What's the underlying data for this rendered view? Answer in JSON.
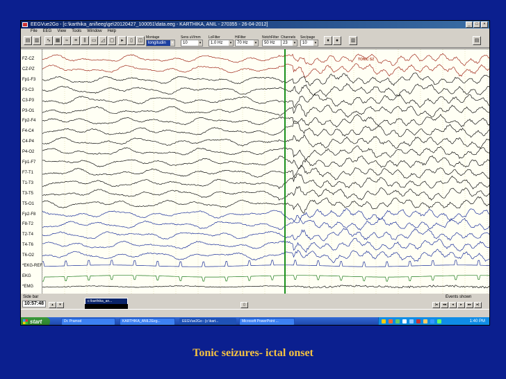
{
  "window": {
    "title": "EEGVue2Go - [c:\\karthika_anil\\eeg\\ge\\20120427_100051\\data.eeg - KARTHIKA, ANIL - 270355 - 26-04-2012]",
    "minimize": "_",
    "restore": "□",
    "close": "×"
  },
  "menu": [
    "File",
    "EEG",
    "View",
    "Tools",
    "Window",
    "Help"
  ],
  "toolbar": {
    "montage": {
      "label": "Montage",
      "value": "longitudin"
    },
    "sensitivity": {
      "label": "Sens uV/mm",
      "value": "10"
    },
    "lo_filter": {
      "label": "LoFilter",
      "value": "1.0 Hz"
    },
    "hi_filter": {
      "label": "HiFilter",
      "value": "70 Hz"
    },
    "notch_filter": {
      "label": "NotchFilter",
      "value": "50 Hz"
    },
    "channels": {
      "label": "Channels",
      "value": "23"
    },
    "sec_page": {
      "label": "Sec/page",
      "value": "10"
    }
  },
  "channels": [
    "FZ-CZ",
    "CZ-PZ",
    "Fp1-F3",
    "F3-C3",
    "C3-P3",
    "P3-O1",
    "Fp2-F4",
    "F4-C4",
    "C4-P4",
    "P4-O2",
    "Fp1-F7",
    "F7-T1",
    "T1-T3",
    "T3-T5",
    "T5-O1",
    "Fp2-F8",
    "F8-T2",
    "T2-T4",
    "T4-T6",
    "T6-O2",
    "*EKG-REF",
    "EKG",
    "*EMG"
  ],
  "event_label": "TONIC SZ",
  "status": {
    "side_label": "Side bar",
    "time": "10:57:48",
    "tooltip": "c:\\karthika_an...",
    "events_label": "Events shown"
  },
  "taskbar": {
    "start": "start",
    "tasks": [
      "Dr. Pramod",
      "KARTHIKA_ANIL2Eeg...",
      "EEGVue2Go - [c:\\kart...",
      "Microsoft PowerPoint ..."
    ],
    "clock": "1:40 PM"
  },
  "caption": "Tonic seizures- ictal onset",
  "colors": {
    "background": "#0b1f8f",
    "caption": "#f5c242",
    "trace_black": "#111111",
    "trace_red": "#a12a1c",
    "trace_blue": "#1b2f9a",
    "trace_green": "#1c7a1c",
    "marker": "#1a8f1a"
  }
}
